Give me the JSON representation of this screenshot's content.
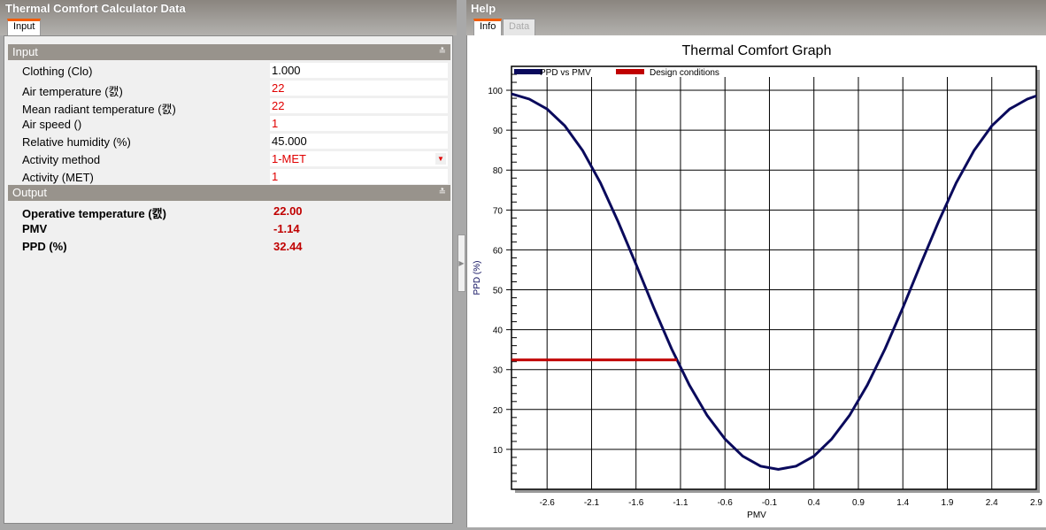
{
  "left_panel": {
    "title": "Thermal Comfort Calculator Data",
    "tabs": [
      {
        "label": "Input",
        "active": true
      }
    ],
    "input_section": {
      "label": "Input",
      "rows": [
        {
          "label": "Clothing (Clo)",
          "value": "1.000",
          "value_color": "#000000"
        },
        {
          "label": "Air temperature (캜)",
          "value": "22",
          "value_color": "#e00000"
        },
        {
          "label": "Mean radiant temperature (캜)",
          "value": "22",
          "value_color": "#e00000"
        },
        {
          "label": "Air speed ()",
          "value": "1",
          "value_color": "#e00000"
        },
        {
          "label": "Relative humidity (%)",
          "value": "45.000",
          "value_color": "#000000"
        },
        {
          "label": "Activity method",
          "value": "1-MET",
          "value_color": "#e00000",
          "dropdown": true
        },
        {
          "label": "Activity (MET)",
          "value": "1",
          "value_color": "#e00000"
        }
      ]
    },
    "output_section": {
      "label": "Output",
      "rows": [
        {
          "label": "Operative temperature (캜)",
          "value": "22.00"
        },
        {
          "label": "PMV",
          "value": "-1.14"
        },
        {
          "label": "PPD (%)",
          "value": "32.44"
        }
      ]
    }
  },
  "right_panel": {
    "title": "Help",
    "tabs": [
      {
        "label": "Info",
        "active": true
      },
      {
        "label": "Data",
        "active": false
      }
    ]
  },
  "chart_data": {
    "type": "line",
    "title": "Thermal Comfort Graph",
    "xlabel": "PMV",
    "ylabel": "PPD (%)",
    "xlim": [
      -3.0,
      2.9
    ],
    "ylim": [
      0,
      106
    ],
    "grid": true,
    "legend": "top-left",
    "xticks": [
      -2.6,
      -2.1,
      -1.6,
      -1.1,
      -0.6,
      -0.1,
      0.4,
      0.9,
      1.4,
      1.9,
      2.4,
      2.9
    ],
    "yticks": [
      10,
      20,
      30,
      40,
      50,
      60,
      70,
      80,
      90,
      100
    ],
    "series": [
      {
        "name": "PPD vs PMV",
        "color": "#0a0a5c",
        "x": [
          -3.0,
          -2.8,
          -2.6,
          -2.4,
          -2.2,
          -2.0,
          -1.8,
          -1.6,
          -1.4,
          -1.2,
          -1.0,
          -0.8,
          -0.6,
          -0.4,
          -0.2,
          0.0,
          0.2,
          0.4,
          0.6,
          0.8,
          1.0,
          1.2,
          1.4,
          1.6,
          1.8,
          2.0,
          2.2,
          2.4,
          2.6,
          2.8,
          2.9
        ],
        "y": [
          99.1,
          97.8,
          95.3,
          91.1,
          84.9,
          76.8,
          67.0,
          56.4,
          45.5,
          35.2,
          26.1,
          18.5,
          12.6,
          8.3,
          5.8,
          5.0,
          5.8,
          8.3,
          12.6,
          18.5,
          26.1,
          35.2,
          45.5,
          56.4,
          67.0,
          76.8,
          84.9,
          91.1,
          95.3,
          97.8,
          98.6
        ]
      },
      {
        "name": "Design conditions",
        "color": "#c00000",
        "x": [
          -3.0,
          -1.14
        ],
        "y": [
          32.44,
          32.44
        ]
      }
    ]
  }
}
